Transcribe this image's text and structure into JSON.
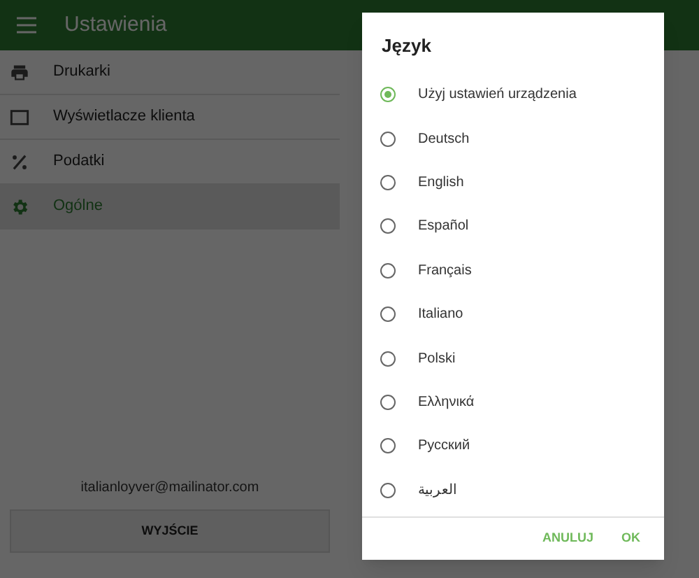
{
  "app_bar": {
    "title": "Ustawienia"
  },
  "sidebar": {
    "items": [
      {
        "label": "Drukarki",
        "kind": "printer",
        "selected": false
      },
      {
        "label": "Wyświetlacze klienta",
        "kind": "display",
        "selected": false
      },
      {
        "label": "Podatki",
        "kind": "percent",
        "selected": false
      },
      {
        "label": "Ogólne",
        "kind": "gear",
        "selected": true
      }
    ],
    "account_email": "italianloyver@mailinator.com",
    "exit_button": "WYJŚCIE"
  },
  "dialog": {
    "title": "Język",
    "options": [
      {
        "label": "Użyj ustawień urządzenia",
        "selected": true
      },
      {
        "label": "Deutsch",
        "selected": false
      },
      {
        "label": "English",
        "selected": false
      },
      {
        "label": "Español",
        "selected": false
      },
      {
        "label": "Français",
        "selected": false
      },
      {
        "label": "Italiano",
        "selected": false
      },
      {
        "label": "Polski",
        "selected": false
      },
      {
        "label": "Ελληνικά",
        "selected": false
      },
      {
        "label": "Русский",
        "selected": false
      },
      {
        "label": "العربية",
        "selected": false
      }
    ],
    "buttons": [
      "ANULUJ",
      "OK"
    ]
  }
}
